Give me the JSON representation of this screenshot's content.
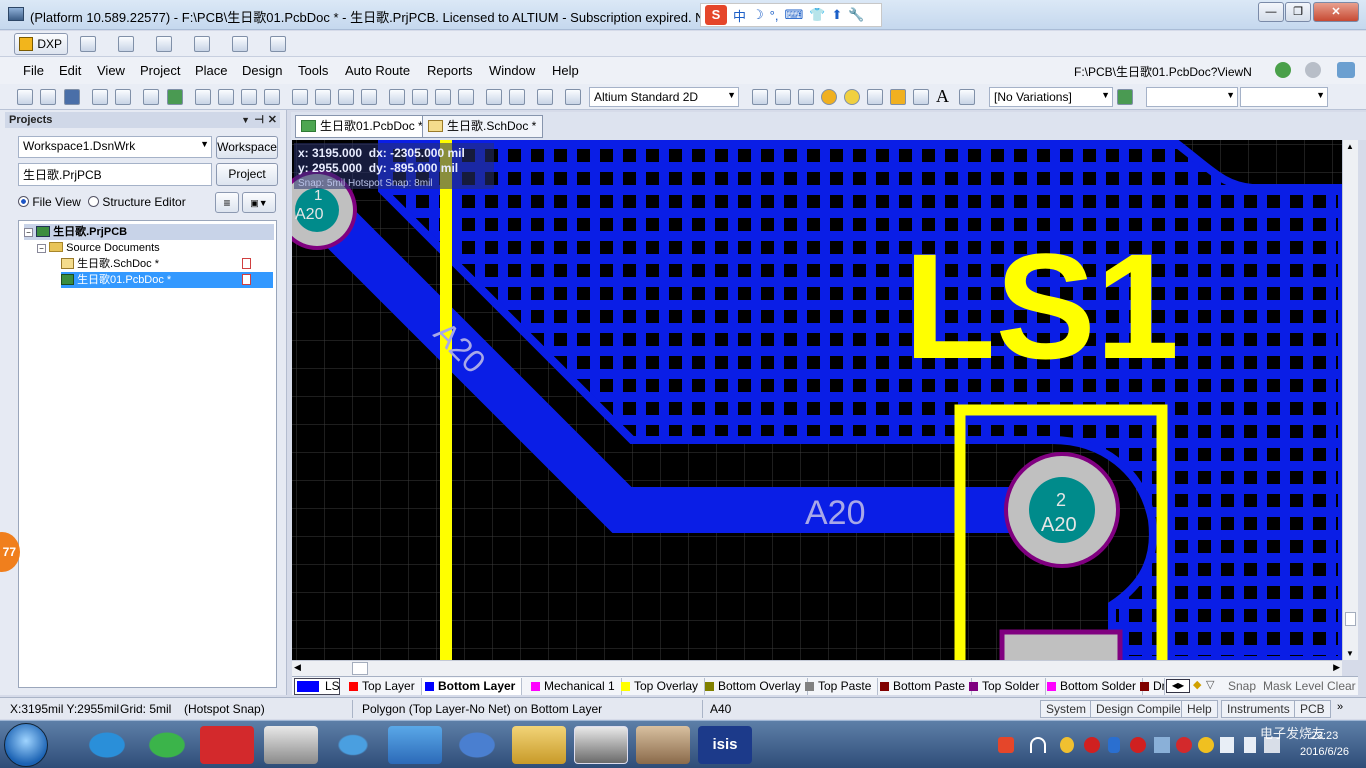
{
  "window": {
    "title": "(Platform 10.589.22577) - F:\\PCB\\生日歌01.PcbDoc * - 生日歌.PrjPCB. Licensed to ALTIUM - Subscription expired. Not",
    "ime": [
      "中",
      "☽",
      "°,",
      "⌨",
      "👕",
      "⬆",
      "🔧"
    ]
  },
  "toolbar1": {
    "dxp_label": "DXP"
  },
  "menu": {
    "items": [
      "File",
      "Edit",
      "View",
      "Project",
      "Place",
      "Design",
      "Tools",
      "Auto Route",
      "Reports",
      "Window",
      "Help"
    ],
    "path": "F:\\PCB\\生日歌01.PcbDoc?ViewN"
  },
  "toolbar3": {
    "view_mode": "Altium Standard 2D",
    "variations": "[No Variations]"
  },
  "projects": {
    "header": "Projects",
    "workspace": "Workspace1.DsnWrk",
    "workspace_btn": "Workspace",
    "project": "生日歌.PrjPCB",
    "project_btn": "Project",
    "file_view": "File View",
    "structure_editor": "Structure Editor",
    "tree": {
      "root": "生日歌.PrjPCB",
      "folder": "Source Documents",
      "files": [
        "生日歌.SchDoc *",
        "生日歌01.PcbDoc *"
      ]
    }
  },
  "doc_tabs": [
    "生日歌01.PcbDoc *",
    "生日歌.SchDoc *"
  ],
  "canvas": {
    "coords": {
      "x": "x: 3195.000",
      "dx": "dx: -2305.000 mil",
      "y": "y: 2955.000",
      "dy": "dy: -895.000 mil",
      "snap": "Snap: 5mil Hotspot Snap: 8mil"
    },
    "pad1_num": "1",
    "pad1_net": "A20",
    "pad2_num": "2",
    "pad2_net": "A20",
    "track_label_diag": "A20",
    "track_label_horiz": "A20",
    "silk_text": "LS1"
  },
  "layers": [
    {
      "name": "LS",
      "color": "#0000ff"
    },
    {
      "name": "Top Layer",
      "color": "#ff0000"
    },
    {
      "name": "Bottom Layer",
      "color": "#0000ff"
    },
    {
      "name": "Mechanical 1",
      "color": "#ff00ff"
    },
    {
      "name": "Top Overlay",
      "color": "#ffff00"
    },
    {
      "name": "Bottom Overlay",
      "color": "#808000"
    },
    {
      "name": "Top Paste",
      "color": "#808080"
    },
    {
      "name": "Bottom Paste",
      "color": "#800000"
    },
    {
      "name": "Top Solder",
      "color": "#800080"
    },
    {
      "name": "Bottom Solder",
      "color": "#ff00ff"
    },
    {
      "name": "Dri",
      "color": "#800000"
    }
  ],
  "layer_right": [
    "Snap",
    "Mask Level",
    "Clear"
  ],
  "status": {
    "pos": "X:3195mil Y:2955mil",
    "grid": "Grid: 5mil",
    "hotspot": "(Hotspot Snap)",
    "object": "Polygon  (Top Layer-No Net)  on Bottom Layer",
    "net": "A40",
    "buttons": [
      "System",
      "Design Compiler",
      "Help",
      "Instruments",
      "PCB"
    ]
  },
  "side_badge": "77",
  "taskbar": {
    "clock_time": "23:23",
    "clock_date": "2016/6/26",
    "watermark": "电子发烧友"
  }
}
